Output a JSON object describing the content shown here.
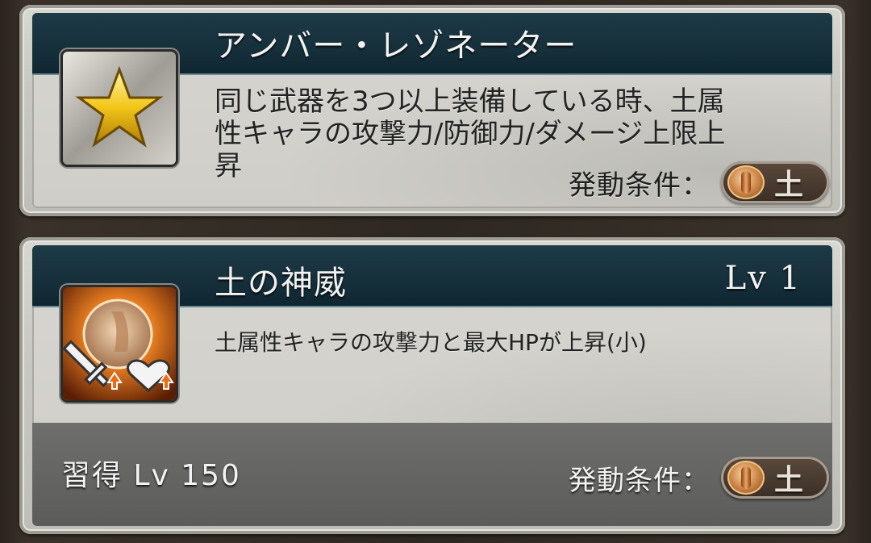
{
  "skill1": {
    "name": "アンバー・レゾネーター",
    "icon": "star-icon",
    "description_lines": [
      "同じ武器を3つ以上装備している時、土属",
      "性キャラの攻撃力/防御力/ダメージ上限上",
      "昇"
    ],
    "condition_label": "発動条件：",
    "element": "土",
    "element_icon": "earth-element-icon"
  },
  "skill2": {
    "name": "土の神威",
    "level": "Lv 1",
    "icon": "earth-might-icon",
    "description": "土属性キャラの攻撃力と最大HPが上昇(小)",
    "acquire": "習得 Lv 150",
    "condition_label": "発動条件：",
    "element": "土",
    "element_icon": "earth-element-icon"
  },
  "colors": {
    "title_bar": "#16303b",
    "card_bg": "#d6d5cf",
    "bottom_strip": "#666664"
  }
}
